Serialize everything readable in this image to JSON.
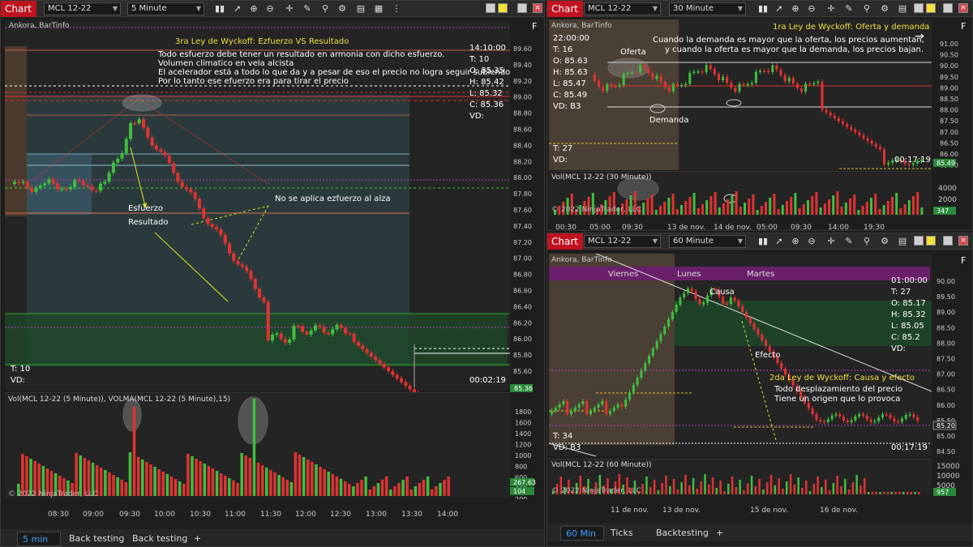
{
  "left": {
    "title": "Chart",
    "instrument": "MCL 12-22",
    "timeframe": "5 Minute",
    "source": "Ankora, BarTinfo",
    "f_label": "F",
    "annot_title": "3ra Ley de Wyckoff: Ezfuerzo VS Resultado",
    "annot_lines": [
      "Todo esfuerzo debe tener un resultado en armonia con dicho esfuerzo.",
      "Volumen climatico en vela alcista",
      "El acelerador está  a todo lo que da y a pesar de eso el precio no logra seguir subiendo",
      "Por lo tanto ese efuerzo era para tirar el precio"
    ],
    "esfuerzo": "Esfuerzo",
    "resultado": "Resultado",
    "no_aplica": "No se aplica ezfuerzo al alza",
    "info": [
      "14:10:00",
      "T: 10",
      "O: 85.35",
      "H: 85.42",
      "L: 85.32",
      "C: 85.36",
      "VD:"
    ],
    "t_label": "T: 10",
    "vd_label": "VD:",
    "timer": "00:02:19",
    "price_ticks": [
      "89.60",
      "89.40",
      "89.20",
      "89.00",
      "88.80",
      "88.60",
      "88.40",
      "88.20",
      "88.00",
      "87.80",
      "87.60",
      "87.40",
      "87.20",
      "87.00",
      "86.80",
      "86.60",
      "86.40",
      "86.20",
      "86.00",
      "85.80",
      "85.60"
    ],
    "price_tag": "85.36",
    "vol_title": "Vol(MCL 12-22 (5 Minute)), VOLMA(MCL 12-22 (5 Minute),15)",
    "vol_ticks": [
      "1800",
      "1600",
      "1400",
      "1200",
      "1000",
      "800",
      "600",
      "400",
      "200"
    ],
    "vol_tag1": "267.63",
    "vol_tag2": "104",
    "copyright": "© 2022 NinjaTrader, LLC",
    "time_ticks": [
      "08:30",
      "09:00",
      "09:30",
      "10:00",
      "10:30",
      "11:00",
      "11:30",
      "12:00",
      "12:30",
      "13:00",
      "13:30",
      "14:00"
    ],
    "tabs": [
      "5 min",
      "Back testing",
      "Back testing"
    ],
    "add": "+"
  },
  "tr": {
    "title": "Chart",
    "instrument": "MCL 12-22",
    "timeframe": "30 Minute",
    "source": "Ankora, BarTinfo",
    "f_label": "F",
    "annot_title": "1ra Ley de Wyckoff: Oferta y demanda",
    "annot_lines": [
      "Cuando la demanda es mayor que la oferta, los precios aumentan,",
      "y cuando la oferta es mayor que la demanda, los precios bajan."
    ],
    "oferta": "Oferta",
    "demanda": "Demanda",
    "info": [
      "22:00:00",
      "T: 16",
      "O: 85.63",
      "H: 85.63",
      "L: 85.47",
      "C: 85.49",
      "VD: B3"
    ],
    "t_label": "T: 27",
    "vd_label": "VD:",
    "timer": "00:17:19",
    "price_ticks": [
      "91.00",
      "90.50",
      "90.00",
      "89.50",
      "89.00",
      "88.50",
      "88.00",
      "87.50",
      "87.00",
      "86.50",
      "86.00",
      "85.50"
    ],
    "price_tag": "85.49",
    "vol_title": "Vol(MCL 12-22 (30 Minute))",
    "vol_ticks": [
      "4000",
      "2000"
    ],
    "vol_tag": "347",
    "copyright": "© 2022 NinjaTrader, LLC",
    "time_ticks": [
      "00:30",
      "05:00",
      "09:30",
      "13 de nov.",
      "00:30",
      "05:00",
      "09:30",
      "14:00",
      "19:30"
    ],
    "time_tick_extra": "14 de nov."
  },
  "br": {
    "title": "Chart",
    "instrument": "MCL 12-22",
    "timeframe": "60 Minute",
    "source": "Ankora, BarTinfo",
    "f_label": "F",
    "days": [
      "Viernes",
      "Lunes",
      "Martes"
    ],
    "causa": "Causa",
    "efecto": "Efecto",
    "annot_title": "2da Ley de Wyckoff: Causa y efecto",
    "annot_lines": [
      "Todo desplazamiento del precio",
      "Tiene un origen que lo provoca"
    ],
    "info": [
      "01:00:00",
      "T: 27",
      "O: 85.17",
      "H: 85.32",
      "L: 85.05",
      "C: 85.2",
      "VD:"
    ],
    "t_label": "T: 34",
    "vd_label": "VD: B3",
    "timer": "00:17:19",
    "price_ticks": [
      "90.00",
      "89.50",
      "89.00",
      "88.50",
      "88.00",
      "87.50",
      "87.00",
      "86.50",
      "86.00",
      "85.50",
      "85.00",
      "84.50"
    ],
    "price_tag": "85.20",
    "vol_title": "Vol(MCL 12-22 (60 Minute))",
    "vol_ticks": [
      "15000",
      "10000",
      "5000"
    ],
    "vol_tag": "957",
    "copyright": "© 2022 NinjaTrader, LLC",
    "time_ticks": [
      "11 de nov.",
      "13 de nov.",
      "15 de nov.",
      "16 de nov."
    ],
    "tabs": [
      "60 Min",
      "Ticks",
      "Backtesting"
    ],
    "add": "+"
  },
  "colors": {
    "up": "#3fbf3f",
    "down": "#e23232",
    "annot": "#f0e040",
    "accent": "#c0121f"
  }
}
